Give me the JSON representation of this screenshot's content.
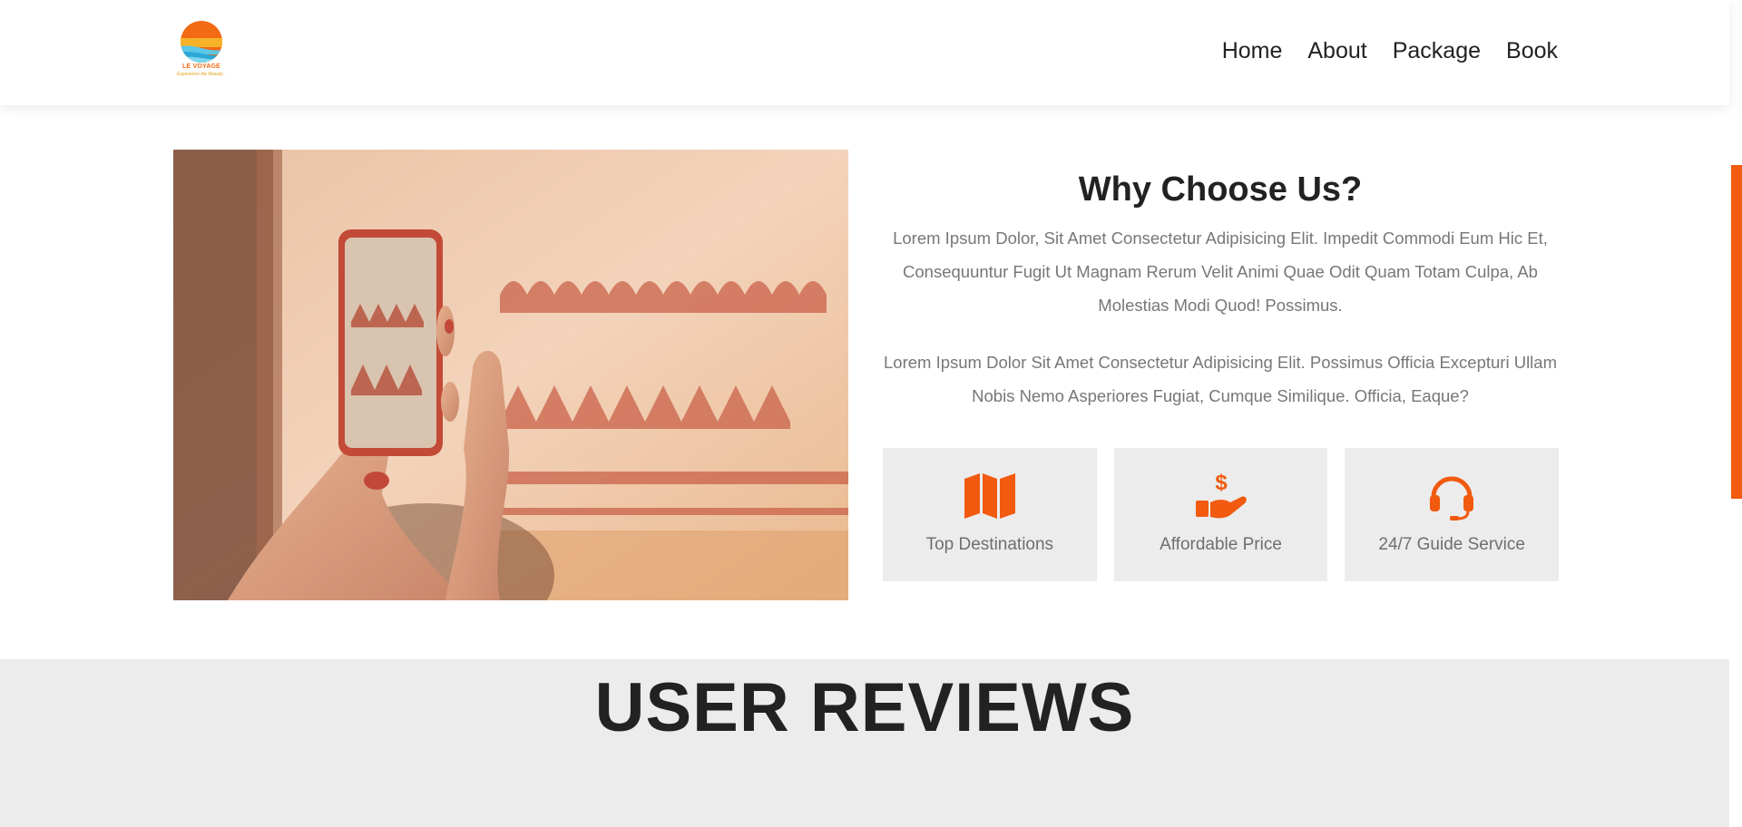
{
  "header": {
    "logo": {
      "name": "LE VOYAGE",
      "tagline": "Experience the Beauty..."
    },
    "nav": [
      "Home",
      "About",
      "Package",
      "Book"
    ]
  },
  "why": {
    "title": "Why Choose Us?",
    "paragraph1": "Lorem Ipsum Dolor, Sit Amet Consectetur Adipisicing Elit. Impedit Commodi Eum Hic Et, Consequuntur Fugit Ut Magnam Rerum Velit Animi Quae Odit Quam Totam Culpa, Ab Molestias Modi Quod! Possimus.",
    "paragraph2": "Lorem Ipsum Dolor Sit Amet Consectetur Adipisicing Elit. Possimus Officia Excepturi Ullam Nobis Nemo Asperiores Fugiat, Cumque Similique. Officia, Eaque?"
  },
  "features": [
    {
      "icon": "map-icon",
      "label": "Top Destinations"
    },
    {
      "icon": "hand-dollar-icon",
      "label": "Affordable Price"
    },
    {
      "icon": "headset-icon",
      "label": "24/7 Guide Service"
    }
  ],
  "reviews": {
    "title": "USER REVIEWS"
  },
  "colors": {
    "accent": "#f15a0f",
    "card_bg": "#ececec",
    "text_muted": "#777777",
    "heading": "#222222"
  }
}
